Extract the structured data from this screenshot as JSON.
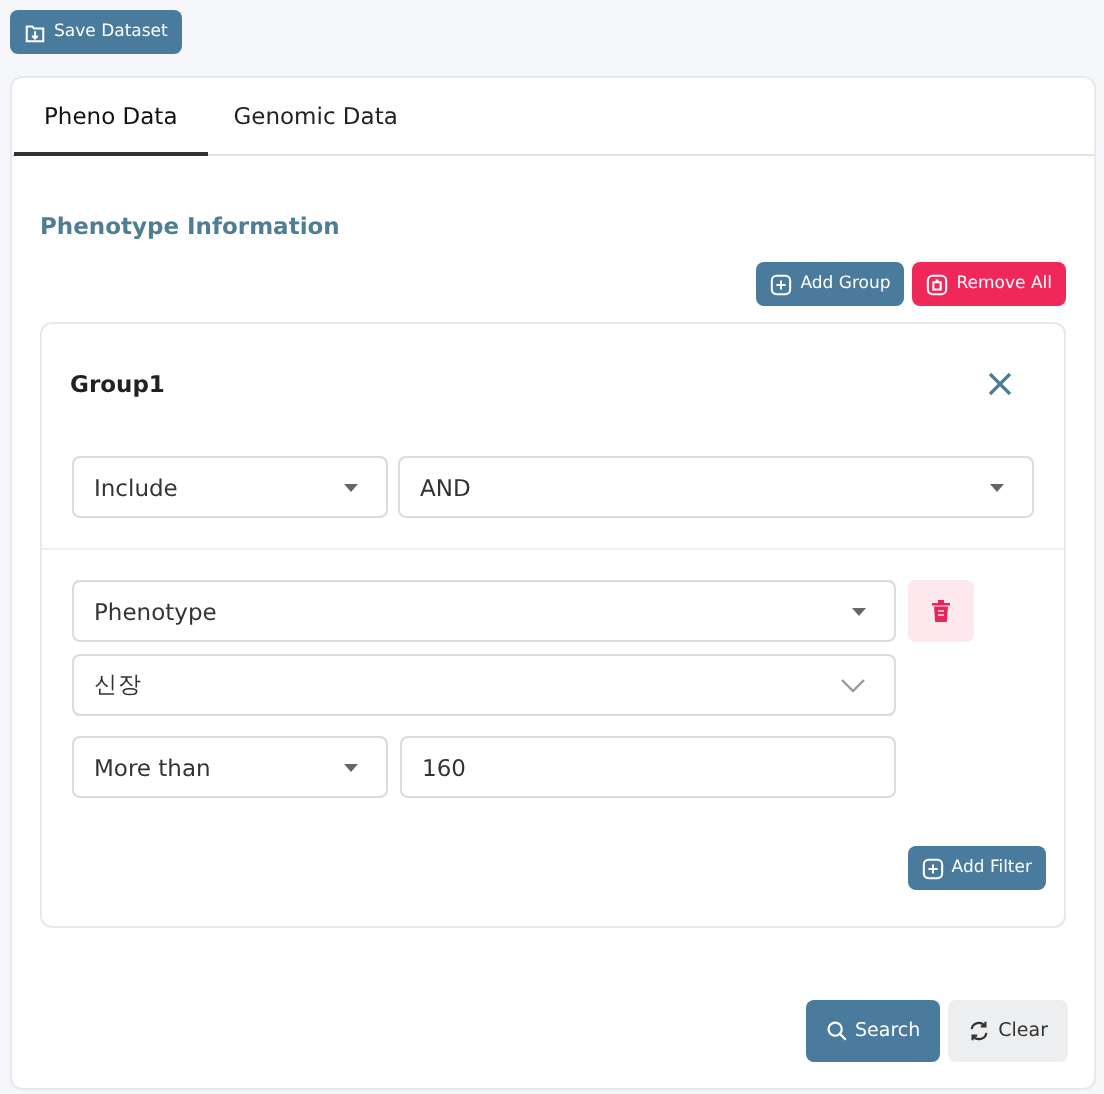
{
  "toolbar": {
    "save_button": "Save Dataset"
  },
  "tabs": [
    {
      "label": "Pheno Data",
      "selected": true
    },
    {
      "label": "Genomic Data",
      "selected": false
    }
  ],
  "section_title": "Phenotype Information",
  "section_buttons": [
    {
      "label": "Add Group",
      "kind": "primary"
    },
    {
      "label": "Remove All",
      "kind": "danger"
    }
  ],
  "groups": [
    {
      "title": "Group1",
      "include": "Include",
      "operator": "AND",
      "filters": [
        {
          "field": "Phenotype",
          "value": "신장",
          "condition": "More than",
          "amount": "160"
        }
      ],
      "add_filter": "Add Filter"
    }
  ],
  "actions": [
    {
      "label": "Search",
      "kind": "primary"
    },
    {
      "label": "Clear",
      "kind": "secondary"
    }
  ]
}
